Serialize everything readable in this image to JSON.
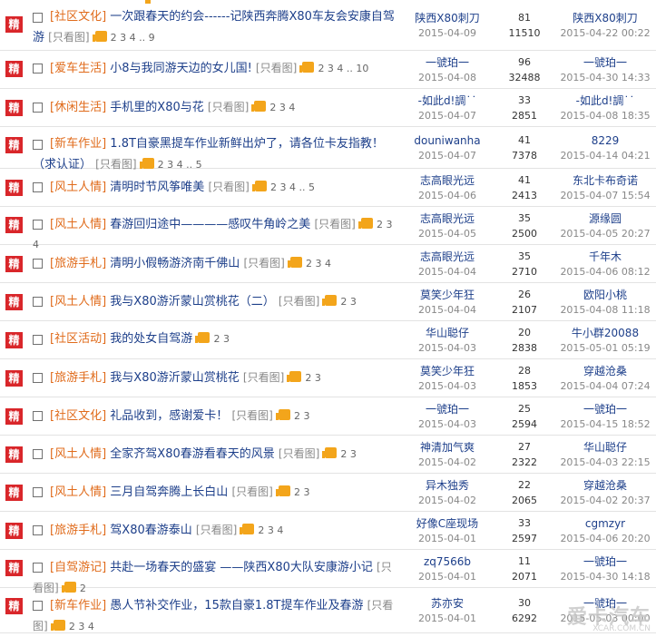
{
  "rows": [
    {
      "jing": "精",
      "category": "[社区文化]",
      "title": "一次跟春天的约会------记陕西奔腾X80车友会安康自驾游",
      "only_img": "[只看图]",
      "pages": "2 3 4 .. 9",
      "author": "陕西X80刺刀",
      "post_date": "2015-04-09",
      "replies": "81",
      "views": "11510",
      "last_user": "陕西X80刺刀",
      "last_date": "2015-04-22 00:22"
    },
    {
      "jing": "精",
      "category": "[爱车生活]",
      "title": "小8与我同游天边的女儿国!",
      "only_img": "[只看图]",
      "pages": "2 3 4 .. 10",
      "author": "一號珀一",
      "post_date": "2015-04-08",
      "replies": "96",
      "views": "32488",
      "last_user": "一號珀一",
      "last_date": "2015-04-30 14:33"
    },
    {
      "jing": "精",
      "category": "[休闲生活]",
      "title": "手机里的X80与花",
      "only_img": "[只看图]",
      "pages": "2 3 4",
      "author": "-如此d!調˙˙",
      "post_date": "2015-04-07",
      "replies": "33",
      "views": "2851",
      "last_user": "-如此d!調˙˙",
      "last_date": "2015-04-08 18:35"
    },
    {
      "jing": "精",
      "category": "[新车作业]",
      "title": "1.8T自豪黑提车作业新鲜出炉了，请各位卡友指教！（求认证）",
      "only_img": "[只看图]",
      "pages": "2 3 4 .. 5",
      "author": "douniwanha",
      "post_date": "2015-04-07",
      "replies": "41",
      "views": "7378",
      "last_user": "8229",
      "last_date": "2015-04-14 04:21"
    },
    {
      "jing": "精",
      "category": "[风土人情]",
      "title": "清明时节风筝唯美",
      "only_img": "[只看图]",
      "pages": "2 3 4 .. 5",
      "author": "志高眼光远",
      "post_date": "2015-04-06",
      "replies": "41",
      "views": "2413",
      "last_user": "东北卡布奇诺",
      "last_date": "2015-04-07 15:54"
    },
    {
      "jing": "精",
      "category": "[风土人情]",
      "title": "春游回归途中————感叹牛角岭之美",
      "only_img": "[只看图]",
      "pages": "2 3 4",
      "author": "志高眼光远",
      "post_date": "2015-04-05",
      "replies": "35",
      "views": "2500",
      "last_user": "源缘圆",
      "last_date": "2015-04-05 20:27"
    },
    {
      "jing": "精",
      "category": "[旅游手札]",
      "title": "清明小假畅游济南千佛山",
      "only_img": "[只看图]",
      "pages": "2 3 4",
      "author": "志高眼光远",
      "post_date": "2015-04-04",
      "replies": "35",
      "views": "2710",
      "last_user": "千年木",
      "last_date": "2015-04-06 08:12"
    },
    {
      "jing": "精",
      "category": "[风土人情]",
      "title": "我与X80游沂蒙山赏桃花（二）",
      "only_img": "[只看图]",
      "pages": "2 3",
      "author": "莫笑少年狂",
      "post_date": "2015-04-04",
      "replies": "26",
      "views": "2107",
      "last_user": "欧阳小桃",
      "last_date": "2015-04-08 11:18"
    },
    {
      "jing": "精",
      "category": "[社区活动]",
      "title": "我的处女自驾游",
      "only_img": "",
      "pages": "2 3",
      "author": "华山聪仔",
      "post_date": "2015-04-03",
      "replies": "20",
      "views": "2838",
      "last_user": "牛小群20088",
      "last_date": "2015-05-01 05:19"
    },
    {
      "jing": "精",
      "category": "[旅游手札]",
      "title": "我与X80游沂蒙山赏桃花",
      "only_img": "[只看图]",
      "pages": "2 3",
      "author": "莫笑少年狂",
      "post_date": "2015-04-03",
      "replies": "28",
      "views": "1853",
      "last_user": "穿越沧桑",
      "last_date": "2015-04-04 07:24"
    },
    {
      "jing": "精",
      "category": "[社区文化]",
      "title": "礼品收到，感谢爱卡！",
      "only_img": "[只看图]",
      "pages": "2 3",
      "author": "一號珀一",
      "post_date": "2015-04-03",
      "replies": "25",
      "views": "2594",
      "last_user": "一號珀一",
      "last_date": "2015-04-15 18:52"
    },
    {
      "jing": "精",
      "category": "[风土人情]",
      "title": "全家齐驾X80春游看春天的风景",
      "only_img": "[只看图]",
      "pages": "2 3",
      "author": "神清加气爽",
      "post_date": "2015-04-02",
      "replies": "27",
      "views": "2322",
      "last_user": "华山聪仔",
      "last_date": "2015-04-03 22:15"
    },
    {
      "jing": "精",
      "category": "[风土人情]",
      "title": "三月自驾奔腾上长白山",
      "only_img": "[只看图]",
      "pages": "2 3",
      "author": "异木独秀",
      "post_date": "2015-04-02",
      "replies": "22",
      "views": "2065",
      "last_user": "穿越沧桑",
      "last_date": "2015-04-02 20:37"
    },
    {
      "jing": "精",
      "category": "[旅游手札]",
      "title": "驾X80春游泰山",
      "only_img": "[只看图]",
      "pages": "2 3 4",
      "author": "好像C座现场",
      "post_date": "2015-04-01",
      "replies": "33",
      "views": "2597",
      "last_user": "cgmzyr",
      "last_date": "2015-04-06 20:20"
    },
    {
      "jing": "精",
      "category": "[自驾游记]",
      "title": "共赴一场春天的盛宴 ——陕西X80大队安康游小记",
      "only_img": "[只看图]",
      "pages": "2",
      "author": "zq7566b",
      "post_date": "2015-04-01",
      "replies": "11",
      "views": "2071",
      "last_user": "一號珀一",
      "last_date": "2015-04-30 14:18"
    },
    {
      "jing": "精",
      "category": "[新车作业]",
      "title": "愚人节补交作业，15款自豪1.8T提车作业及春游",
      "only_img": "[只看图]",
      "pages": "2 3 4",
      "author": "苏亦安",
      "post_date": "2015-04-01",
      "replies": "30",
      "views": "6292",
      "last_user": "一號珀一",
      "last_date": "2015-05-03 00:00"
    }
  ],
  "watermark": {
    "main": "爱卡汽车",
    "sub": "XCAR.COM.CN"
  },
  "colors": {
    "jing_bg": "#d9262a",
    "category": "#e06b1b",
    "title": "#1d3f8a",
    "thumb": "#f3a51b"
  }
}
